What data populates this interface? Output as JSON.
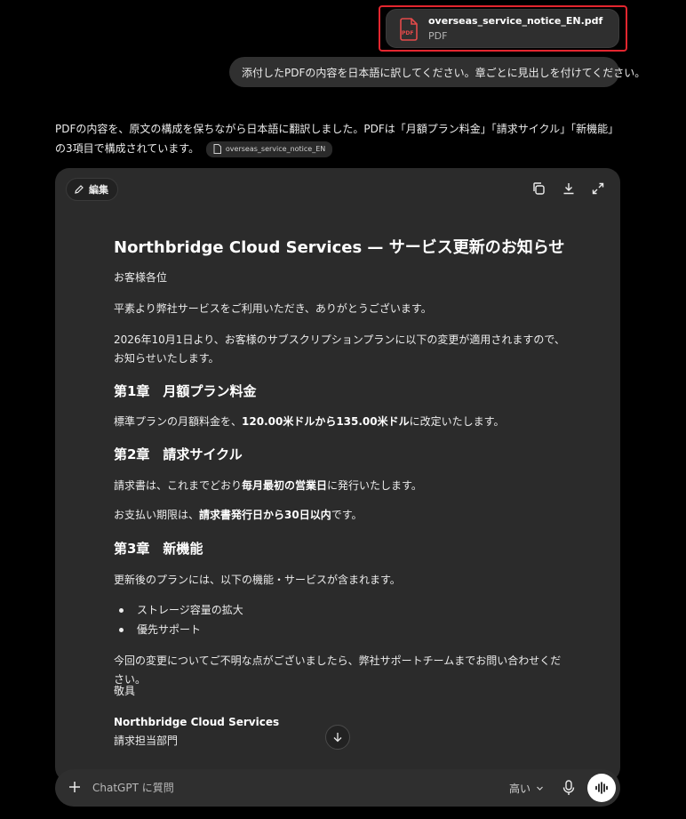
{
  "attachment": {
    "filename": "overseas_service_notice_EN.pdf",
    "filetype": "PDF",
    "icon": "pdf-file-icon",
    "highlight_color": "#e3262f"
  },
  "user_message": "添付したPDFの内容を日本語に訳してください。章ごとに見出しを付けてください。",
  "assistant": {
    "intro": "PDFの内容を、原文の構成を保ちながら日本語に翻訳しました。PDFは「月額プラン料金」「請求サイクル」「新機能」の3項目で構成されています。",
    "file_chip": "overseas_service_notice_EN"
  },
  "canvas": {
    "edit_label": "編集",
    "toolbar_icons": [
      "copy-icon",
      "download-icon",
      "expand-icon"
    ],
    "title": "Northbridge Cloud Services — サービス更新のお知らせ",
    "salutation": "お客様各位",
    "greeting": "平素より弊社サービスをご利用いただき、ありがとうございます。",
    "notice": "2026年10月1日より、お客様のサブスクリプションプランに以下の変更が適用されますので、お知らせいたします。",
    "sections": [
      {
        "heading": "第1章　月額プラン料金",
        "p1_prefix": "標準プランの月額料金を、",
        "p1_bold": "120.00米ドルから135.00米ドル",
        "p1_suffix": "に改定いたします。"
      },
      {
        "heading": "第2章　請求サイクル",
        "p1_prefix": "請求書は、これまでどおり",
        "p1_bold": "毎月最初の営業日",
        "p1_suffix": "に発行いたします。",
        "p2_prefix": "お支払い期限は、",
        "p2_bold": "請求書発行日から30日以内",
        "p2_suffix": "です。"
      },
      {
        "heading": "第3章　新機能",
        "intro": "更新後のプランには、以下の機能・サービスが含まれます。",
        "bullets": [
          "ストレージ容量の拡大",
          "優先サポート"
        ]
      }
    ],
    "closing_text": "今回の変更についてご不明な点がございましたら、弊社サポートチームまでお問い合わせください。",
    "sign_off": "敬具",
    "company": "Northbridge Cloud Services",
    "department": "請求担当部門"
  },
  "composer": {
    "placeholder": "ChatGPT に質問",
    "model_label": "高い"
  }
}
